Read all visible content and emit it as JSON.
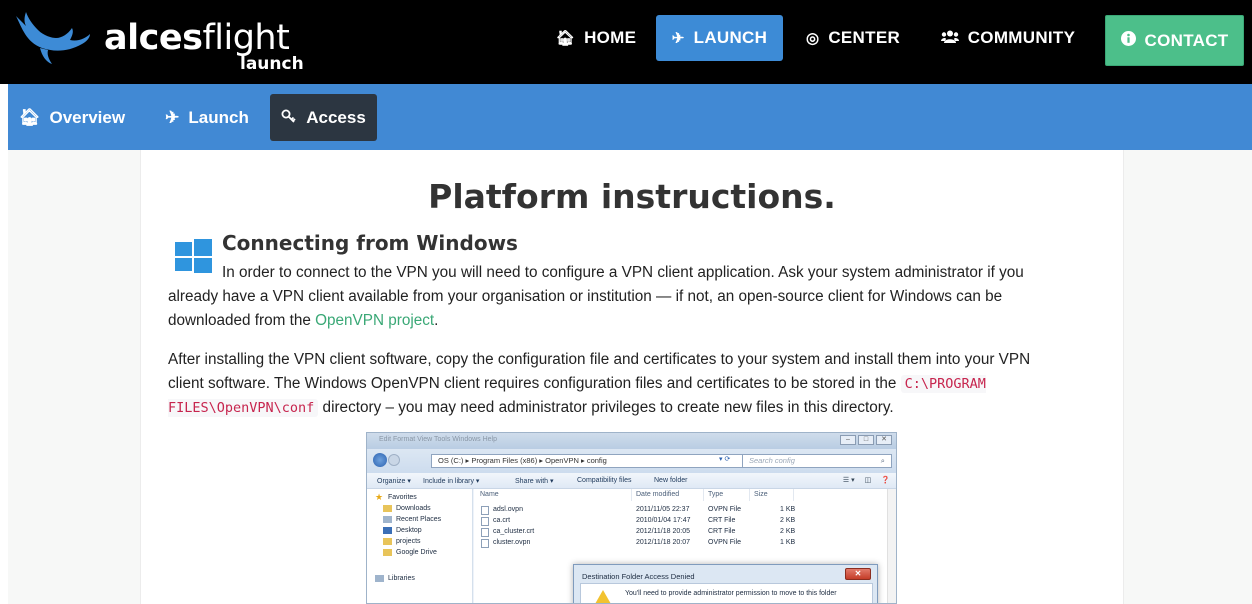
{
  "brand": {
    "name_bold": "alces",
    "name_light": "flight",
    "sub": "launch",
    "colors": {
      "topbar": "#000000",
      "accent_blue": "#3d8bd6",
      "contact_green": "#4cbf8a",
      "subnav": "#4189d4",
      "active_sub": "#2c3641",
      "link": "#3aa876"
    }
  },
  "topnav": {
    "home": {
      "icon": "home-icon",
      "label": "HOME"
    },
    "launch": {
      "icon": "plane-icon",
      "label": "LAUNCH"
    },
    "center": {
      "icon": "target-icon",
      "label": "CENTER"
    },
    "community": {
      "icon": "users-icon",
      "label": "COMMUNITY"
    },
    "contact": {
      "icon": "info-icon",
      "label": "CONTACT"
    }
  },
  "subnav": {
    "overview": {
      "icon": "home-icon",
      "label": "Overview"
    },
    "launch": {
      "icon": "plane-icon",
      "label": "Launch"
    },
    "access": {
      "icon": "key-icon",
      "label": "Access"
    }
  },
  "page": {
    "title": "Platform instructions.",
    "section_title": "Connecting from Windows",
    "p1_text": "In order to connect to the VPN you will need to configure a VPN client application. Ask your system administrator if you already have a VPN client available from your organisation or institution — if not, an open-source client for Windows can be downloaded from the ",
    "p1_link": "OpenVPN project",
    "p1_end": ".",
    "p2_text": "After installing the VPN client software, copy the configuration file and certificates to your system and install them into your VPN client software. The Windows OpenVPN client requires configuration files and certificates to be stored in the ",
    "p2_code": "C:\\PROGRAM FILES\\OpenVPN\\conf",
    "p2_end": " directory – you may need administrator privileges to create new files in this directory."
  },
  "screenshot": {
    "menu": "Edit   Format   View   Tools   Windows   Help",
    "address": "OS (C:)  ▸  Program Files (x86)  ▸  OpenVPN  ▸  config",
    "search_placeholder": "Search config",
    "toolbar": [
      "Organize ▾",
      "Include in library ▾",
      "Share with ▾",
      "Compatibility files",
      "New folder"
    ],
    "nav_items": [
      "Favorites",
      "Downloads",
      "Recent Places",
      "Desktop",
      "projects",
      "Google Drive",
      "Libraries"
    ],
    "columns": [
      "Name",
      "Date modified",
      "Type",
      "Size"
    ],
    "files": [
      {
        "name": "adsl.ovpn",
        "date": "2011/11/05 22:37",
        "type": "OVPN File",
        "size": "1 KB"
      },
      {
        "name": "ca.crt",
        "date": "2010/01/04 17:47",
        "type": "CRT File",
        "size": "2 KB"
      },
      {
        "name": "ca_cluster.crt",
        "date": "2012/11/18 20:05",
        "type": "CRT File",
        "size": "2 KB"
      },
      {
        "name": "cluster.ovpn",
        "date": "2012/11/18 20:07",
        "type": "OVPN File",
        "size": "1 KB"
      }
    ],
    "dialog_title": "Destination Folder Access Denied",
    "dialog_text": "You'll need to provide administrator permission to move to this folder"
  }
}
